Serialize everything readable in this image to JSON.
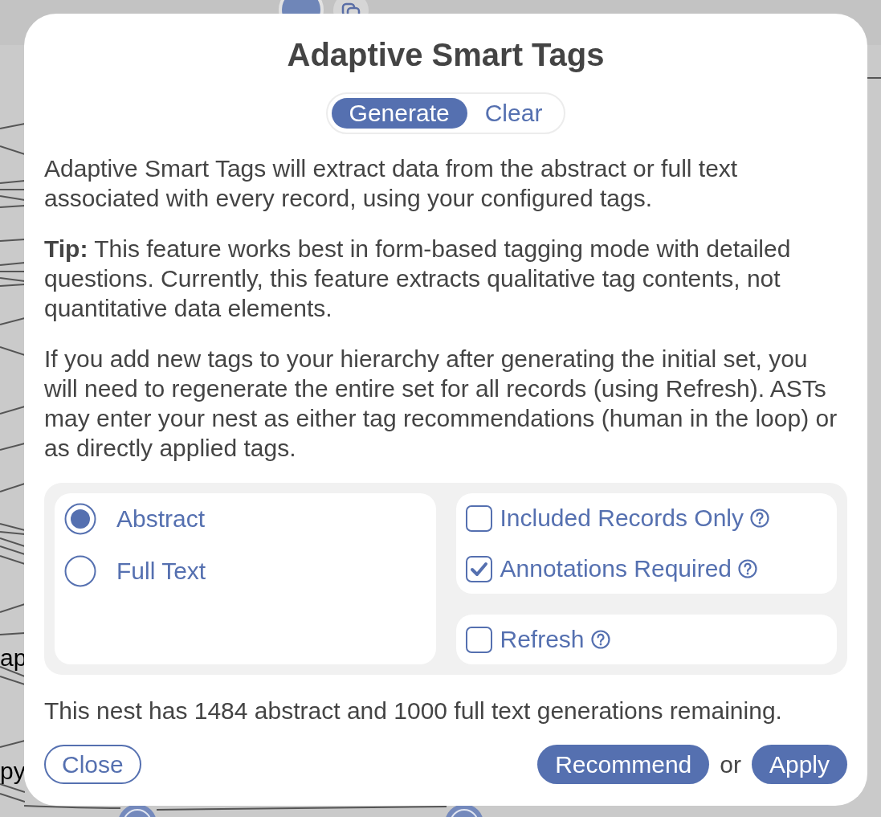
{
  "background": {
    "node_labels": [
      "ap",
      "py"
    ]
  },
  "dialog": {
    "title": "Adaptive Smart Tags",
    "mode_tabs": [
      {
        "label": "Generate",
        "selected": true
      },
      {
        "label": "Clear",
        "selected": false
      }
    ],
    "paragraphs": [
      "Adaptive Smart Tags will extract data from the abstract or full text associated with every record, using your configured tags.",
      "**Tip:** This feature works best in form-based tagging mode with detailed questions. Currently, this feature extracts qualitative tag contents, not quantitative data elements.",
      "If you add new tags to your hierarchy after generating the initial set, you will need to regenerate the entire set for all records (using Refresh). ASTs may enter your nest as either tag recommendations (human in the loop) or as directly applied tags."
    ],
    "source_options": [
      {
        "label": "Abstract",
        "selected": true
      },
      {
        "label": "Full Text",
        "selected": false
      }
    ],
    "option_groups": [
      [
        {
          "label": "Included Records Only",
          "checked": false,
          "help": true
        },
        {
          "label": "Annotations Required",
          "checked": true,
          "help": true
        }
      ],
      [
        {
          "label": "Refresh",
          "checked": false,
          "help": true
        }
      ]
    ],
    "remaining_note": "This nest has 1484 abstract and 1000 full text generations remaining.",
    "close_button": "Close",
    "recommend_button": "Recommend",
    "separator": "or",
    "apply_button": "Apply"
  }
}
